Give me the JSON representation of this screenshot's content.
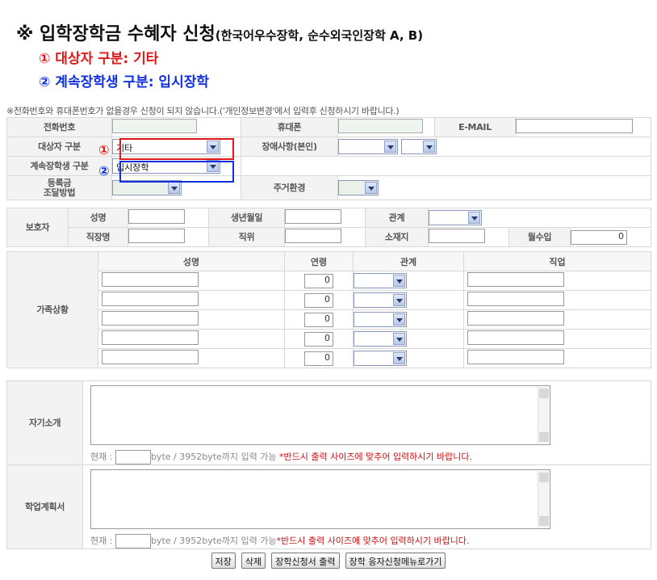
{
  "header": {
    "title_main": "※ 입학장학금 수혜자 신청",
    "title_sub": "(한국어우수장학, 순수외국인장학 A, B)",
    "line1": "① 대상자 구분: 기타",
    "line2": "② 계속장학생 구분: 입시장학",
    "note": "※전화번호와 휴대폰번호가 없을경우 신청이 되지 않습니다.('개인정보변경'에서 입력후 신청하시기 바랍니다.)"
  },
  "colors": {
    "red": "#e01818",
    "blue": "#1030e0",
    "warn": "#cc1010"
  },
  "markers": {
    "one": "①",
    "two": "②"
  },
  "basic": {
    "phone_label": "전화번호",
    "mobile_label": "휴대폰",
    "email_label": "E-MAIL",
    "target_label": "대상자 구분",
    "target_value": "기타",
    "disability_label": "장애사항(본인)",
    "continuing_label": "계속장학생 구분",
    "continuing_value": "입시장학",
    "tuition_label_1": "등록금",
    "tuition_label_2": "조달방법",
    "housing_label": "주거환경"
  },
  "guardian": {
    "section_label": "보호자",
    "name_label": "성명",
    "birth_label": "생년월일",
    "relation_label": "관계",
    "workplace_label": "직장명",
    "position_label": "직위",
    "address_label": "소재지",
    "income_label": "월수입",
    "income_value": "0"
  },
  "family": {
    "section_label": "가족상황",
    "columns": [
      "성명",
      "연령",
      "관계",
      "직업"
    ],
    "rows": [
      {
        "age": "0"
      },
      {
        "age": "0"
      },
      {
        "age": "0"
      },
      {
        "age": "0"
      },
      {
        "age": "0"
      }
    ]
  },
  "intro": {
    "label": "자기소개",
    "count_prefix": "현재 :",
    "count_suffix": "byte / 3952byte까지 입력 가능",
    "warning": "*반드시 출력 사이즈에 맞추어 입력하시기 바랍니다."
  },
  "plan": {
    "label": "학업계획서",
    "count_prefix": "현재 :",
    "count_suffix": "byte / 3952byte까지 입력 가능",
    "warning": "*반드시 출력 사이즈에 맞추어 입력하시기 바랍니다."
  },
  "buttons": {
    "save": "저장",
    "delete": "삭제",
    "print": "장학신청서 출력",
    "menu": "장학 응자신청메뉴로가기"
  }
}
